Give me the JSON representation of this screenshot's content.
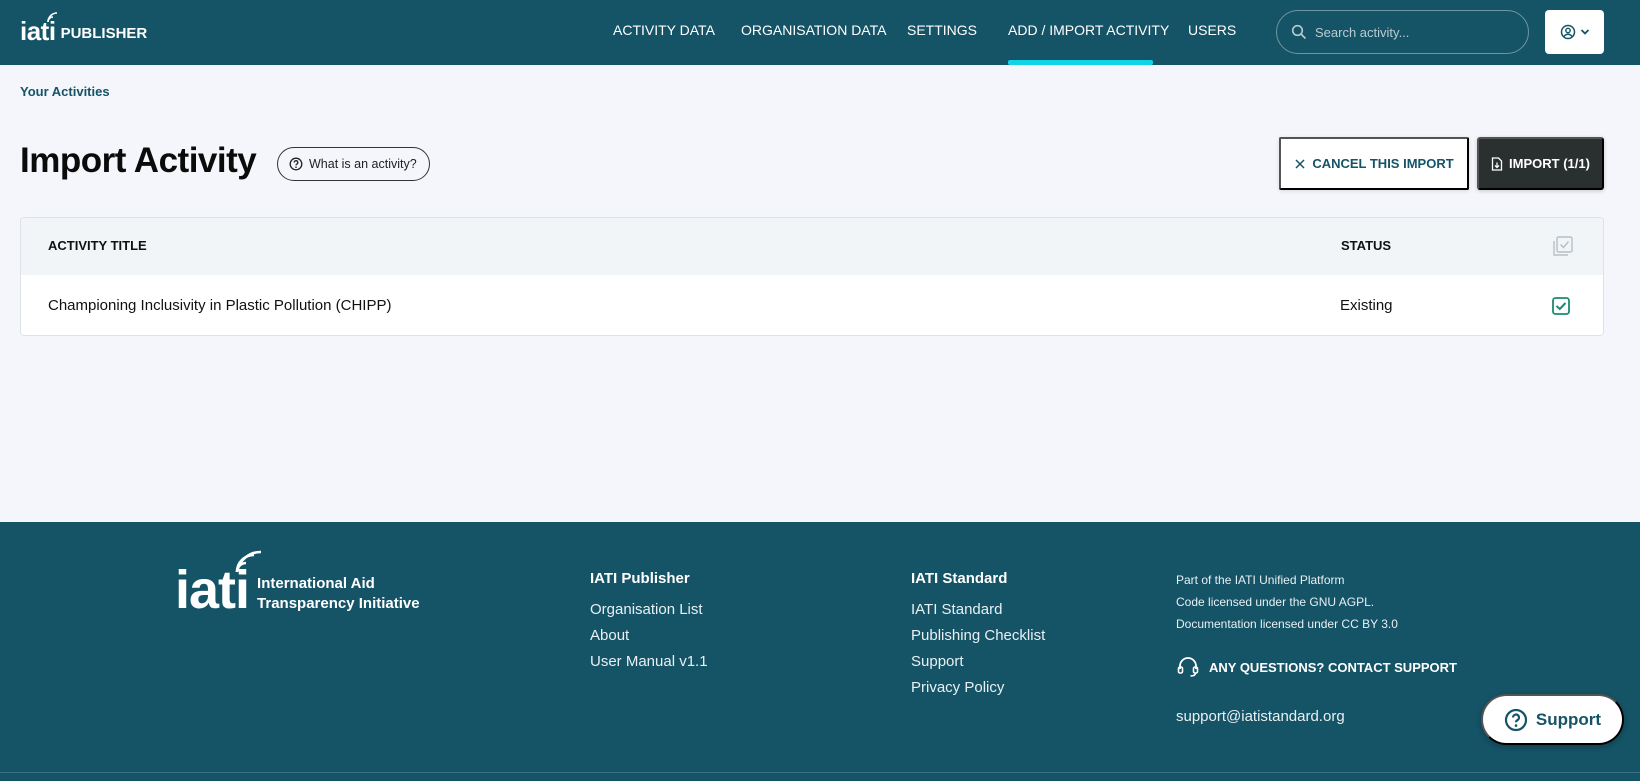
{
  "header": {
    "logo_mark": "iati",
    "logo_text": "PUBLISHER",
    "nav": [
      {
        "label": "ACTIVITY DATA"
      },
      {
        "label": "ORGANISATION DATA"
      },
      {
        "label": "SETTINGS"
      },
      {
        "label": "ADD / IMPORT ACTIVITY"
      },
      {
        "label": "USERS"
      }
    ],
    "active_nav": "ADD / IMPORT ACTIVITY",
    "search_placeholder": "Search activity...",
    "icons": {
      "search": "search-icon",
      "user": "user-circle-icon",
      "chevron": "chevron-down-icon"
    }
  },
  "breadcrumb": "Your Activities",
  "page": {
    "title": "Import Activity",
    "help_label": "What is an activity?",
    "cancel_label": "CANCEL THIS IMPORT",
    "import_label": "IMPORT (1/1)"
  },
  "table": {
    "headers": {
      "title": "ACTIVITY TITLE",
      "status": "STATUS"
    },
    "rows": [
      {
        "title": "Championing Inclusivity in Plastic Pollution (CHIPP)",
        "status": "Existing",
        "checked": true
      }
    ]
  },
  "footer": {
    "logo_mark": "iati",
    "logo_line1": "International Aid",
    "logo_line2": "Transparency Initiative",
    "col1": {
      "heading": "IATI Publisher",
      "links": [
        "Organisation List",
        "About",
        "User Manual v1.1"
      ]
    },
    "col2": {
      "heading": "IATI Standard",
      "links": [
        "IATI Standard",
        "Publishing Checklist",
        "Support",
        "Privacy Policy"
      ]
    },
    "meta": [
      "Part of the IATI Unified Platform",
      "Code licensed under the GNU AGPL.",
      "Documentation licensed under CC BY 3.0"
    ],
    "contact_label": "ANY QUESTIONS? CONTACT SUPPORT",
    "email": "support@iatistandard.org"
  },
  "support_widget": "Support",
  "colors": {
    "header": "#155366",
    "accent": "#11d3e6",
    "check": "#1a8a74",
    "dark_button": "#2a2f2f"
  }
}
